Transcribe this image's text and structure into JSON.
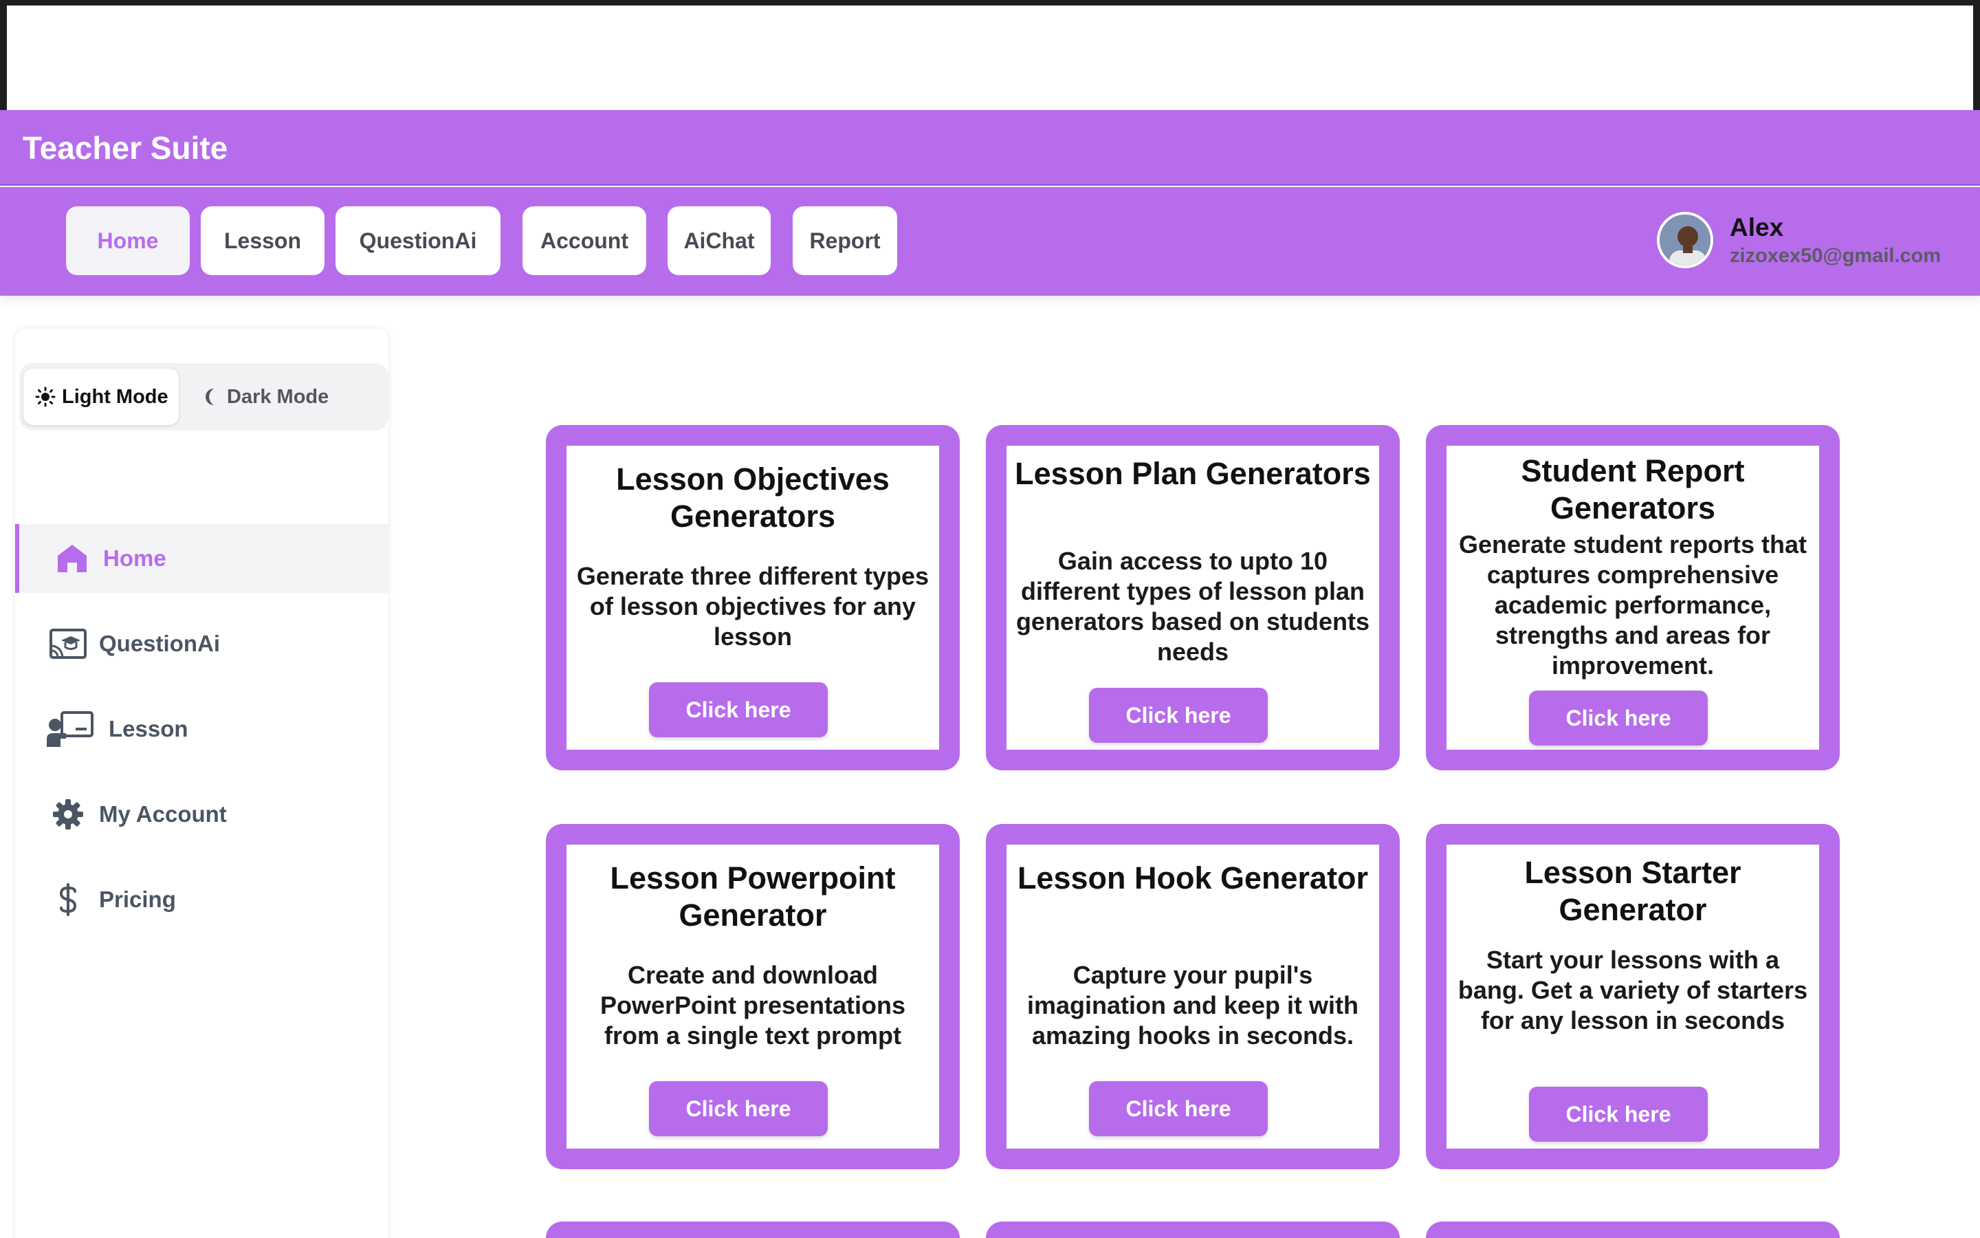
{
  "app": {
    "title": "Teacher Suite"
  },
  "nav": {
    "items": [
      {
        "label": "Home",
        "active": true
      },
      {
        "label": "Lesson"
      },
      {
        "label": "QuestionAi"
      },
      {
        "label": "Account"
      },
      {
        "label": "AiChat"
      },
      {
        "label": "Report"
      }
    ]
  },
  "user": {
    "name": "Alex",
    "email": "zizoxex50@gmail.com"
  },
  "theme": {
    "light_label": "Light Mode",
    "dark_label": "Dark Mode",
    "selected": "Light Mode"
  },
  "sidebar": {
    "items": [
      {
        "label": "Home",
        "icon": "home-icon",
        "active": true
      },
      {
        "label": "QuestionAi",
        "icon": "question-ai-icon"
      },
      {
        "label": "Lesson",
        "icon": "lesson-presenter-icon"
      },
      {
        "label": "My Account",
        "icon": "gear-icon"
      },
      {
        "label": "Pricing",
        "icon": "dollar-icon"
      }
    ]
  },
  "cards": [
    {
      "title": "Lesson Objectives Generators",
      "description": "Generate three different types of lesson objectives for any lesson",
      "button": "Click here"
    },
    {
      "title": "Lesson Plan Generators",
      "description": "Gain access to upto  10 different types of lesson plan generators based on students needs",
      "button": "Click here"
    },
    {
      "title": "Student Report Generators",
      "description": "Generate student reports that captures comprehensive academic performance, strengths and areas for improvement.",
      "button": "Click here"
    },
    {
      "title": "Lesson Powerpoint Generator",
      "description": "Create and download PowerPoint presentations from a single text prompt",
      "button": "Click here"
    },
    {
      "title": "Lesson Hook Generator",
      "description": "Capture your pupil's imagination and keep it with amazing hooks in seconds.",
      "button": "Click here"
    },
    {
      "title": "Lesson Starter Generator",
      "description": "Start your lessons with a bang. Get a variety of starters for any lesson in seconds",
      "button": "Click here"
    }
  ],
  "colors": {
    "accent": "#b76cec",
    "nav_inactive_text": "#4a4a55",
    "sidebar_text": "#4b5563"
  }
}
